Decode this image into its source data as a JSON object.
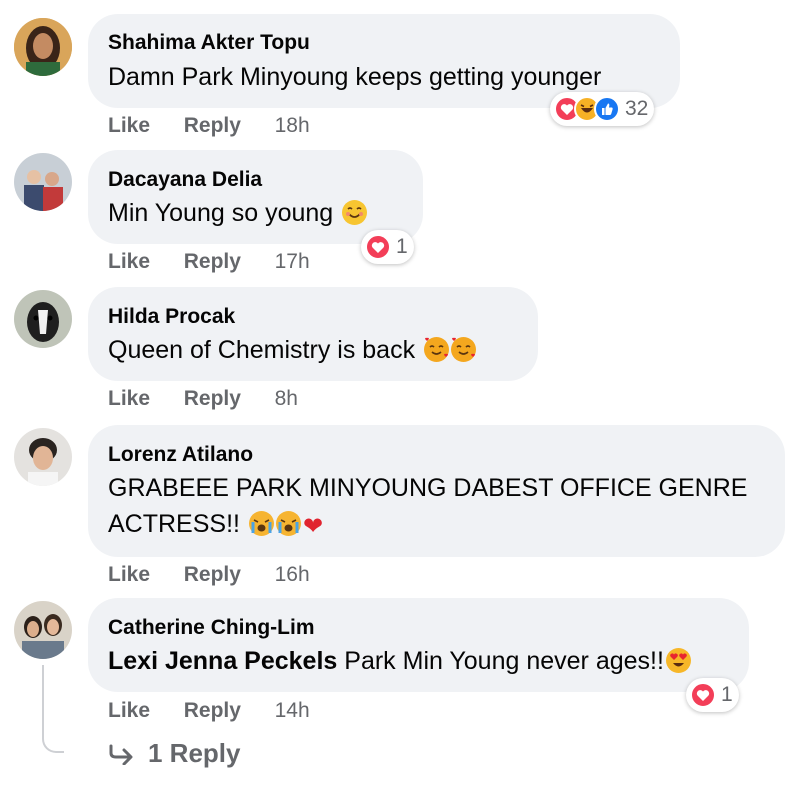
{
  "comments": [
    {
      "author": "Shahima Akter Topu",
      "text": "Damn Park Minyoung keeps getting younger",
      "reaction_count": "32",
      "like": "Like",
      "reply": "Reply",
      "time": "18h"
    },
    {
      "author": "Dacayana Delia",
      "text": "Min Young so young",
      "reaction_count": "1",
      "like": "Like",
      "reply": "Reply",
      "time": "17h"
    },
    {
      "author": "Hilda Procak",
      "text": "Queen of Chemistry is back",
      "like": "Like",
      "reply": "Reply",
      "time": "8h"
    },
    {
      "author": "Lorenz Atilano",
      "text": "GRABEEE PARK MINYOUNG DABEST OFFICE GENRE ACTRESS!!",
      "like": "Like",
      "reply": "Reply",
      "time": "16h"
    },
    {
      "author": "Catherine Ching-Lim",
      "mention": "Lexi Jenna Peckels",
      "text": "Park Min Young never ages!!",
      "reaction_count": "1",
      "like": "Like",
      "reply": "Reply",
      "time": "14h"
    }
  ],
  "replies_link": "1 Reply",
  "icons": [
    "love-reaction-icon",
    "haha-reaction-icon",
    "like-reaction-icon",
    "smile-emoji-icon",
    "smiling-face-with-hearts-emoji-icon",
    "crying-face-emoji-icon",
    "red-heart-emoji-icon",
    "heart-eyes-emoji-icon",
    "reply-arrow-icon"
  ],
  "colors": {
    "bubble": "#f0f2f5",
    "meta": "#65676b",
    "love": "#f33e58",
    "like": "#1877f2",
    "haha": "#f7b125"
  }
}
